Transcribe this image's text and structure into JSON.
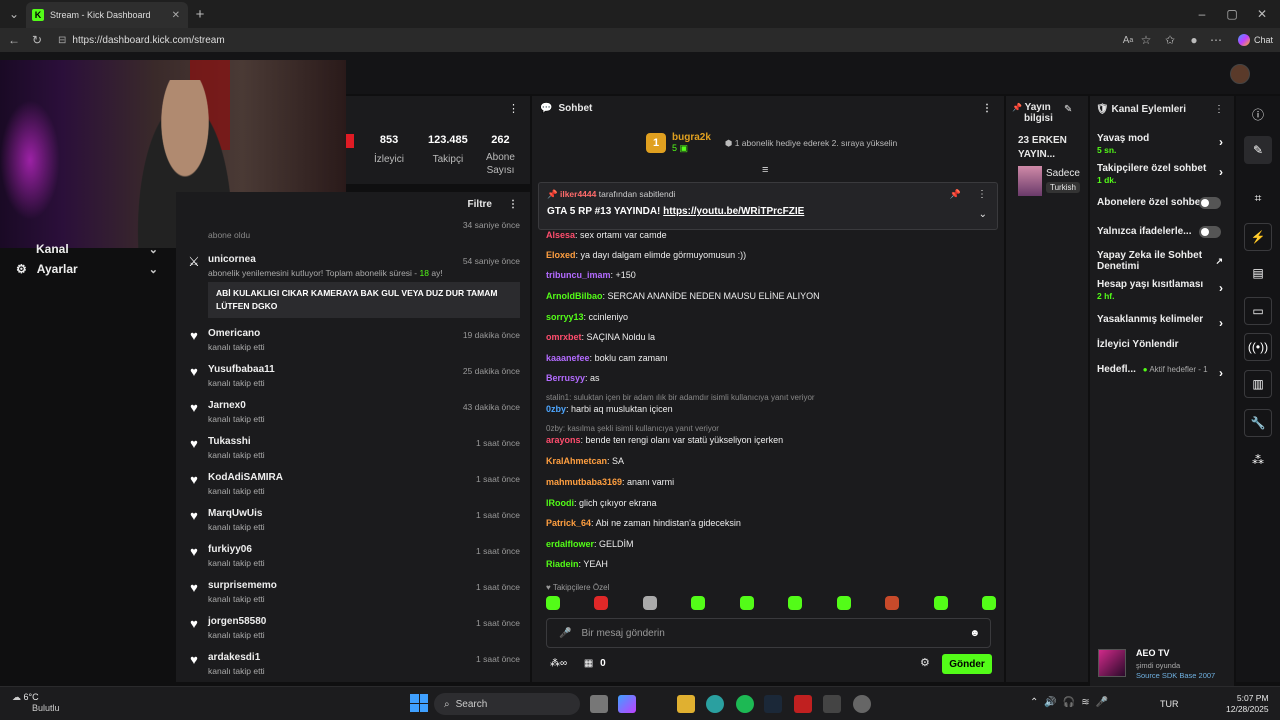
{
  "browser": {
    "tab_title": "Stream - Kick Dashboard",
    "url": "https://dashboard.kick.com/stream",
    "chat_label": "Chat"
  },
  "left_menu": {
    "items": [
      {
        "label": "Kanal"
      },
      {
        "label": "Ayarlar"
      }
    ]
  },
  "stats": {
    "viewers": "853",
    "viewers_label": "İzleyici",
    "followers": "123.485",
    "followers_label": "Takipçi",
    "subs": "262",
    "subs_label_1": "Abone",
    "subs_label_2": "Sayısı"
  },
  "activity": {
    "filter_label": "Filtre",
    "top_sub": "abone oldu",
    "top_time": "34 saniye önce",
    "resub": {
      "name": "unicornea",
      "time": "54 saniye önce",
      "text": "abonelik yenilemesini kutluyor! Toplam abonelik süresi -",
      "months": "18",
      "months_suffix": "ay!",
      "message": "ABİ KULAKLIGI CIKAR KAMERAYA BAK GUL VEYA DUZ DUR TAMAM LÜTFEN DGKO"
    },
    "follows": [
      {
        "name": "Omericano",
        "time": "19 dakika önce",
        "sub": "kanalı takip etti"
      },
      {
        "name": "Yusufbabaa11",
        "time": "25 dakika önce",
        "sub": "kanalı takip etti"
      },
      {
        "name": "Jarnex0",
        "time": "43 dakika önce",
        "sub": "kanalı takip etti"
      },
      {
        "name": "Tukasshi",
        "time": "1 saat önce",
        "sub": "kanalı takip etti"
      },
      {
        "name": "KodAdiSAMIRA",
        "time": "1 saat önce",
        "sub": "kanalı takip etti"
      },
      {
        "name": "MarqUwUis",
        "time": "1 saat önce",
        "sub": "kanalı takip etti"
      },
      {
        "name": "furkiyy06",
        "time": "1 saat önce",
        "sub": "kanalı takip etti"
      },
      {
        "name": "surprisememo",
        "time": "1 saat önce",
        "sub": "kanalı takip etti"
      },
      {
        "name": "jorgen58580",
        "time": "1 saat önce",
        "sub": "kanalı takip etti"
      },
      {
        "name": "ardakesdi1",
        "time": "1 saat önce",
        "sub": "kanalı takip etti"
      }
    ]
  },
  "chat": {
    "title": "Sohbet",
    "gift_user": "bugra2k",
    "gift_count": "5",
    "gift_rank": "1",
    "gift_text": "1 abonelik hediye ederek 2. sıraya yükselin",
    "pinned_by": "ilker4444",
    "pinned_by_suffix": "tarafından sabitlendi",
    "pinned_text": "GTA 5 RP #13 YAYINDA!",
    "pinned_link": "https://youtu.be/WRiTPrcFZIE",
    "messages": [
      {
        "user": "Alsesa",
        "color": "#ff4d6d",
        "text": "sex ortamı var camde"
      },
      {
        "user": "Eloxed",
        "color": "#ff9f40",
        "text": "ya dayı dalgam elimde görmuyomusun :))"
      },
      {
        "user": "tribuncu_imam",
        "color": "#b36bff",
        "text": "+150"
      },
      {
        "user": "ArnoldBilbao",
        "color": "#53fc18",
        "text": "SERCAN ANANİDE NEDEN MAUSU ELİNE ALIYON"
      },
      {
        "user": "sorryy13",
        "color": "#53fc18",
        "text": "ccinleniyo"
      },
      {
        "user": "omrxbet",
        "color": "#ff4d6d",
        "text": "SAÇINA Noldu la"
      },
      {
        "user": "kaaanefee",
        "color": "#b36bff",
        "text": "boklu cam zamanı"
      },
      {
        "user": "Berrusyy",
        "color": "#b36bff",
        "text": "as"
      },
      {
        "user": "0zby",
        "color": "#4da6ff",
        "text": "harbi aq musluktan içicen"
      },
      {
        "user": "arayons",
        "color": "#ff4d6d",
        "text": "bende ten rengi olanı var statü yükseliyon içerken"
      },
      {
        "user": "KralAhmetcan",
        "color": "#ff9f40",
        "text": "SA"
      },
      {
        "user": "mahmutbaba3169",
        "color": "#ff9f40",
        "text": "ananı varmi"
      },
      {
        "user": "lRoodi",
        "color": "#53fc18",
        "text": "glich çıkıyor ekrana"
      },
      {
        "user": "Patrick_64",
        "color": "#ff9f40",
        "text": "Abi ne zaman hindistan'a gideceksin"
      },
      {
        "user": "erdalflower",
        "color": "#53fc18",
        "text": "GELDİM"
      },
      {
        "user": "Riadein",
        "color": "#53fc18",
        "text": "YEAH"
      }
    ],
    "reply1": "stalin1: suluktan içen bir adam ılık bir adamdır isimli kullanıcıya yanıt veriyor",
    "reply2": "0zby: kasılma şekli isimli kullanıcıya yanıt veriyor",
    "followers_only": "Takipçilere Özel",
    "input_placeholder": "Bir mesaj gönderin",
    "points": "0",
    "send_label": "Gönder"
  },
  "stream_info": {
    "title_1": "Yayın",
    "title_2": "bilgisi",
    "stream_title_1": "23 ERKEN",
    "stream_title_2": "YAYIN...",
    "category_short": "Sadece",
    "lang": "Turkish"
  },
  "actions": {
    "title": "Kanal Eylemleri",
    "slow_mode": "Yavaş mod",
    "slow_mode_val": "5 sn.",
    "followers_chat": "Takipçilere özel sohbet",
    "followers_chat_val": "1 dk.",
    "subs_chat": "Abonelere özel sohbet",
    "emotes_only": "Yalnızca ifadelerle...",
    "ai_moderation_1": "Yapay Zeka ile Sohbet",
    "ai_moderation_2": "Denetimi",
    "age_limit": "Hesap yaşı kısıtlaması",
    "age_limit_val": "2 hf.",
    "banned_words": "Yasaklanmış kelimeler",
    "redirect": "İzleyici Yönlendir",
    "goals": "Hedefl...",
    "goals_val": "Aktif hedefler - 1"
  },
  "toast": {
    "name": "AEO TV",
    "status": "şimdi oyunda",
    "game": "Source SDK Base 2007"
  },
  "taskbar": {
    "temp": "6°C",
    "weather": "Bulutlu",
    "search": "Search",
    "lang": "TUR",
    "time": "5:07 PM",
    "date": "12/28/2025"
  },
  "colors": {
    "accent": "#53fc18",
    "bg": "#0f0f10",
    "panel": "#1b1b1d"
  }
}
